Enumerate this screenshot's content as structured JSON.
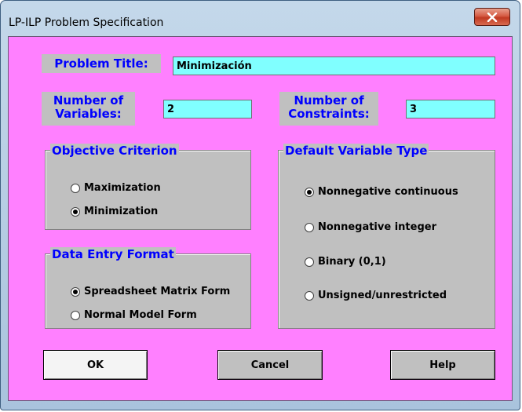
{
  "window": {
    "title": "LP-ILP Problem Specification"
  },
  "colors": {
    "client_background": "#ff80ff",
    "label_text": "#0000ff",
    "field_background": "#80ffff",
    "panel": "#c0c0c0"
  },
  "icons": {
    "close": "close-icon"
  },
  "form": {
    "problem_title_label": "Problem Title:",
    "problem_title_value": "Minimización",
    "num_variables_label_line1": "Number of",
    "num_variables_label_line2": "Variables:",
    "num_variables_value": "2",
    "num_constraints_label_line1": "Number of",
    "num_constraints_label_line2": "Constraints:",
    "num_constraints_value": "3"
  },
  "objective": {
    "title": "Objective Criterion",
    "options": [
      {
        "label": "Maximization",
        "selected": false
      },
      {
        "label": "Minimization",
        "selected": true
      }
    ]
  },
  "data_entry": {
    "title": "Data Entry Format",
    "options": [
      {
        "label": "Spreadsheet Matrix Form",
        "selected": true
      },
      {
        "label": "Normal Model Form",
        "selected": false
      }
    ]
  },
  "variable_type": {
    "title": "Default Variable Type",
    "options": [
      {
        "label": "Nonnegative continuous",
        "selected": true
      },
      {
        "label": "Nonnegative integer",
        "selected": false
      },
      {
        "label": "Binary (0,1)",
        "selected": false
      },
      {
        "label": "Unsigned/unrestricted",
        "selected": false
      }
    ]
  },
  "buttons": {
    "ok": "OK",
    "cancel": "Cancel",
    "help": "Help"
  }
}
